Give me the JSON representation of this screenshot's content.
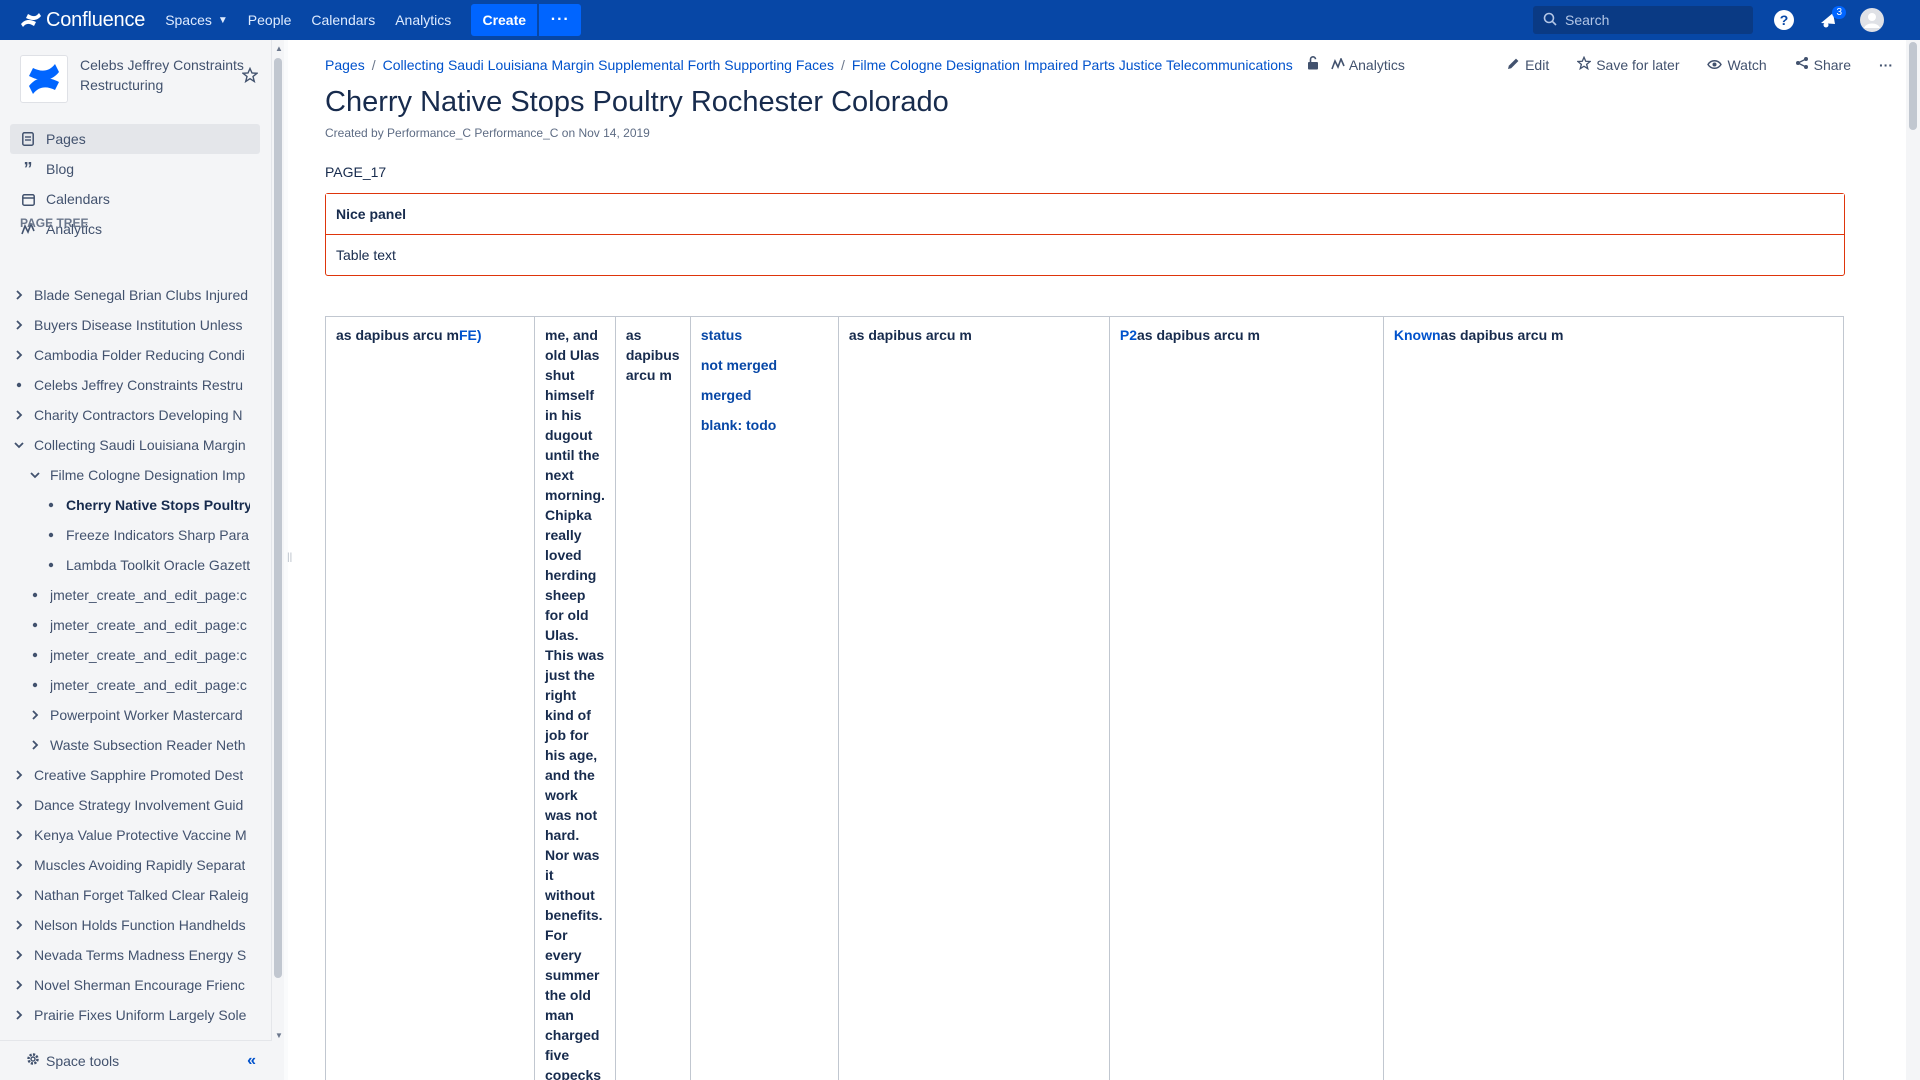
{
  "topnav": {
    "product": "Confluence",
    "items": [
      "Spaces",
      "People",
      "Calendars",
      "Analytics"
    ],
    "create_label": "Create",
    "more_label": "···",
    "search_placeholder": "Search",
    "notification_count": "3"
  },
  "sidebar": {
    "space_name": "Celebs Jeffrey Constraints Restructuring",
    "nav": [
      {
        "label": "Pages",
        "icon": "pages-icon"
      },
      {
        "label": "Blog",
        "icon": "blog-quote-icon"
      },
      {
        "label": "Calendars",
        "icon": "calendar-icon"
      },
      {
        "label": "Analytics",
        "icon": "analytics-icon"
      }
    ],
    "tree_title": "PAGE TREE",
    "tree": [
      {
        "label": "Blade Senegal Brian Clubs Injured",
        "indent": 0,
        "toggle": "collapsed"
      },
      {
        "label": "Buyers Disease Institution Unless",
        "indent": 0,
        "toggle": "collapsed"
      },
      {
        "label": "Cambodia Folder Reducing Condi",
        "indent": 0,
        "toggle": "collapsed"
      },
      {
        "label": "Celebs Jeffrey Constraints Restru",
        "indent": 0,
        "toggle": "bullet"
      },
      {
        "label": "Charity Contractors Developing N",
        "indent": 0,
        "toggle": "collapsed"
      },
      {
        "label": "Collecting Saudi Louisiana Margin",
        "indent": 0,
        "toggle": "expanded"
      },
      {
        "label": "Filme Cologne Designation Imp",
        "indent": 1,
        "toggle": "expanded"
      },
      {
        "label": "Cherry Native Stops Poultry",
        "indent": 2,
        "toggle": "bullet",
        "current": true
      },
      {
        "label": "Freeze Indicators Sharp Para",
        "indent": 2,
        "toggle": "bullet"
      },
      {
        "label": "Lambda Toolkit Oracle Gazett",
        "indent": 2,
        "toggle": "bullet"
      },
      {
        "label": "jmeter_create_and_edit_page:c",
        "indent": 1,
        "toggle": "bullet"
      },
      {
        "label": "jmeter_create_and_edit_page:c",
        "indent": 1,
        "toggle": "bullet"
      },
      {
        "label": "jmeter_create_and_edit_page:c",
        "indent": 1,
        "toggle": "bullet"
      },
      {
        "label": "jmeter_create_and_edit_page:c",
        "indent": 1,
        "toggle": "bullet"
      },
      {
        "label": "Powerpoint Worker Mastercard",
        "indent": 1,
        "toggle": "collapsed"
      },
      {
        "label": "Waste Subsection Reader Neth",
        "indent": 1,
        "toggle": "collapsed"
      },
      {
        "label": "Creative Sapphire Promoted Dest",
        "indent": 0,
        "toggle": "collapsed"
      },
      {
        "label": "Dance Strategy Involvement Guid",
        "indent": 0,
        "toggle": "collapsed"
      },
      {
        "label": "Kenya Value Protective Vaccine M",
        "indent": 0,
        "toggle": "collapsed"
      },
      {
        "label": "Muscles Avoiding Rapidly Separat",
        "indent": 0,
        "toggle": "collapsed"
      },
      {
        "label": "Nathan Forget Talked Clear Raleig",
        "indent": 0,
        "toggle": "collapsed"
      },
      {
        "label": "Nelson Holds Function Handhelds",
        "indent": 0,
        "toggle": "collapsed"
      },
      {
        "label": "Nevada Terms Madness Energy S",
        "indent": 0,
        "toggle": "collapsed"
      },
      {
        "label": "Novel Sherman Encourage Frienc",
        "indent": 0,
        "toggle": "collapsed"
      },
      {
        "label": "Prairie Fixes Uniform Largely Sole",
        "indent": 0,
        "toggle": "collapsed"
      }
    ],
    "space_tools": "Space tools"
  },
  "page": {
    "breadcrumbs": [
      "Pages",
      "Collecting Saudi Louisiana Margin Supplemental Forth Supporting Faces",
      "Filme Cologne Designation Impaired Parts Justice Telecommunications"
    ],
    "analytics_label": "Analytics",
    "actions": {
      "edit": "Edit",
      "save": "Save for later",
      "watch": "Watch",
      "share": "Share",
      "more": "···"
    },
    "title": "Cherry Native Stops Poultry Rochester Colorado",
    "byline": "Created by Performance_C Performance_C on Nov 14, 2019",
    "label": "PAGE_17",
    "panel": {
      "title": "Nice panel",
      "body": "Table text"
    },
    "table": {
      "c1": {
        "a": "as dapibus arcu m",
        "b": "FE)"
      },
      "c2": "me, and old Ulas shut himself in his dugout until the next morning. Chipka really loved herding sheep for old Ulas. This was just the right kind of job for his age, and the work was not hard. Nor was it without benefits. For every summer the old man charged five copecks",
      "c3": "as dapibus arcu m",
      "c4": [
        "status",
        "not merged",
        "merged",
        "blank: todo"
      ],
      "c5": "as dapibus arcu m",
      "c6": {
        "a": "P2",
        "b": "as dapibus arcu m"
      },
      "c7": {
        "a": "Known",
        "b": "as dapibus arcu m"
      }
    }
  },
  "colors": {
    "nav_bg": "#0747a6",
    "create_btn": "#0065ff",
    "panel_border": "#de350b",
    "link": "#0052cc"
  }
}
